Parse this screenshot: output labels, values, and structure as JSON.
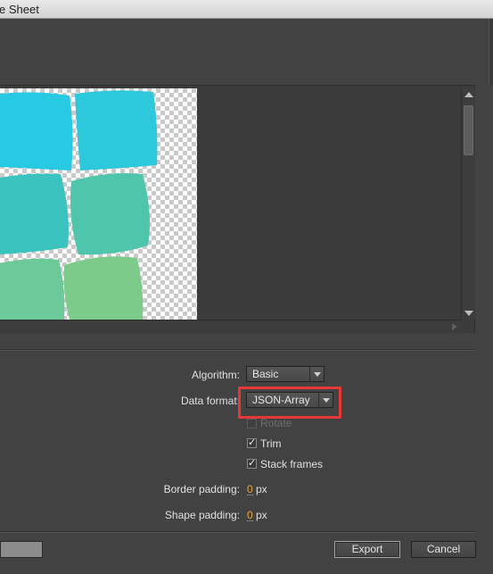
{
  "window": {
    "title": "e Sheet"
  },
  "options": {
    "algorithm": {
      "label": "Algorithm:",
      "value": "Basic"
    },
    "data_format": {
      "label": "Data format:",
      "value": "JSON-Array"
    },
    "rotate": {
      "label": "Rotate",
      "checked": false,
      "enabled": false
    },
    "trim": {
      "label": "Trim",
      "checked": true
    },
    "stack_frames": {
      "label": "Stack frames",
      "checked": true
    },
    "border_padding": {
      "label": "Border padding:",
      "value": "0",
      "unit": "px"
    },
    "shape_padding": {
      "label": "Shape padding:",
      "value": "0",
      "unit": "px"
    }
  },
  "footer": {
    "export_label": "Export",
    "cancel_label": "Cancel"
  },
  "icons": {
    "check": "✓"
  },
  "colors": {
    "sprite_cyan": "#27c9e3",
    "sprite_teal": "#4fc6ab",
    "sprite_green": "#7dcb8a",
    "highlight": "#e53935",
    "numeric_value": "#e8a33b"
  }
}
